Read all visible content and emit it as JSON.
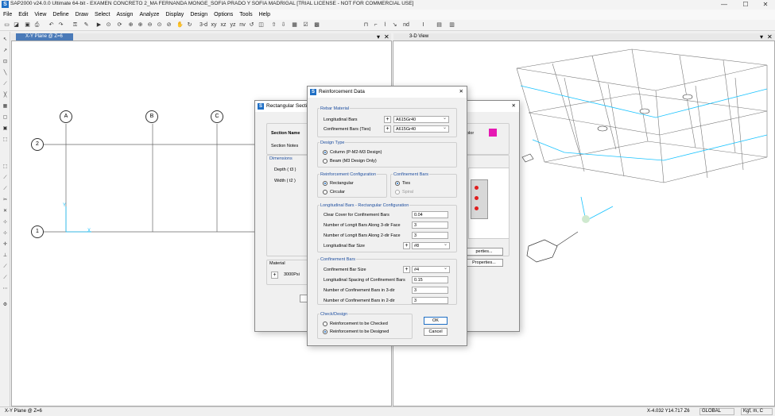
{
  "window": {
    "title": "SAP2000 v24.0.0 Ultimate 64-bit - EXAMEN CONCRETO 2_MA FERNANDA MONGE_SOFIA PRADO Y SOFIA MADRIGAL  [TRIAL LICENSE - NOT FOR COMMERCIAL USE]",
    "minimize": "—",
    "maximize": "☐",
    "close": "✕",
    "app_icon": "S"
  },
  "menu": [
    "File",
    "Edit",
    "View",
    "Define",
    "Draw",
    "Select",
    "Assign",
    "Analyze",
    "Display",
    "Design",
    "Options",
    "Tools",
    "Help"
  ],
  "toolbar": {
    "view_3d": "3-d",
    "view_xy": "xy",
    "view_xz": "xz",
    "view_yz": "yz",
    "view_nv": "nv",
    "view_nd": "nd"
  },
  "panes": {
    "left": {
      "tab": "X-Y Plane @ Z=6",
      "close": "✕",
      "pin": "▾"
    },
    "right": {
      "tab": "3-D View",
      "close": "✕",
      "pin": "▾"
    }
  },
  "plan": {
    "grid_x": [
      "A",
      "B",
      "C"
    ],
    "grid_y": [
      "2",
      "1"
    ],
    "axis_x": "X",
    "axis_y": "Y"
  },
  "rect_dialog": {
    "title": "Rectangular Section",
    "close": "✕",
    "section_name_label": "Section Name",
    "section_notes_label": "Section Notes",
    "dimensions_label": "Dimensions",
    "depth_label": "Depth  ( t3 )",
    "width_label": "Width  ( t2 )",
    "color_label": "olor",
    "material_label": "Material",
    "material_value": "3000Psi",
    "properties_btn": "perties...",
    "properties_btn2": "Properties...",
    "color_swatch": "#e619b3"
  },
  "reinf_dialog": {
    "title": "Reinforcement Data",
    "close": "✕",
    "rebar_material": {
      "label": "Rebar Material",
      "longitudinal_label": "Longitudinal Bars",
      "longitudinal_value": "A615Gr40",
      "confinement_label": "Confinement Bars  (Ties)",
      "confinement_value": "A615Gr40"
    },
    "design_type": {
      "label": "Design Type",
      "column": "Column  (P-M2-M3 Design)",
      "beam": "Beam  (M3 Design Only)"
    },
    "reinf_config": {
      "label": "Reinforcement Configuration",
      "rectangular": "Rectangular",
      "circular": "Circular"
    },
    "confinement_bars": {
      "label": "Confinement Bars",
      "ties": "Ties",
      "spiral": "Spiral"
    },
    "longit_rect": {
      "label": "Longitudinal Bars - Rectangular Configuration",
      "clear_cover_label": "Clear Cover for Confinement Bars",
      "clear_cover_value": "0.04",
      "n3_label": "Number of Longit Bars Along 3-dir Face",
      "n3_value": "3",
      "n2_label": "Number of Longit Bars Along 2-dir Face",
      "n2_value": "3",
      "bar_size_label": "Longitudinal Bar Size",
      "bar_size_value": "#8"
    },
    "confinement": {
      "label": "Confinement Bars",
      "size_label": "Confinement Bar Size",
      "size_value": "#4",
      "spacing_label": "Longitudinal Spacing of Confinement Bars",
      "spacing_value": "0.15",
      "n3_label": "Number of Confinement Bars in 3-dir",
      "n3_value": "3",
      "n2_label": "Number of Confinement Bars in 2-dir",
      "n2_value": "3"
    },
    "check_design": {
      "label": "Check/Design",
      "checked": "Reinforcement to be Checked",
      "designed": "Reinforcement to be Designed"
    },
    "ok": "OK",
    "cancel": "Cancel",
    "plus": "+"
  },
  "status": {
    "left": "X-Y Plane @ Z=6",
    "coords": "X-4.032  Y14.717  Z6",
    "coord_sys": "GLOBAL",
    "units": "Kgf, m, C"
  }
}
